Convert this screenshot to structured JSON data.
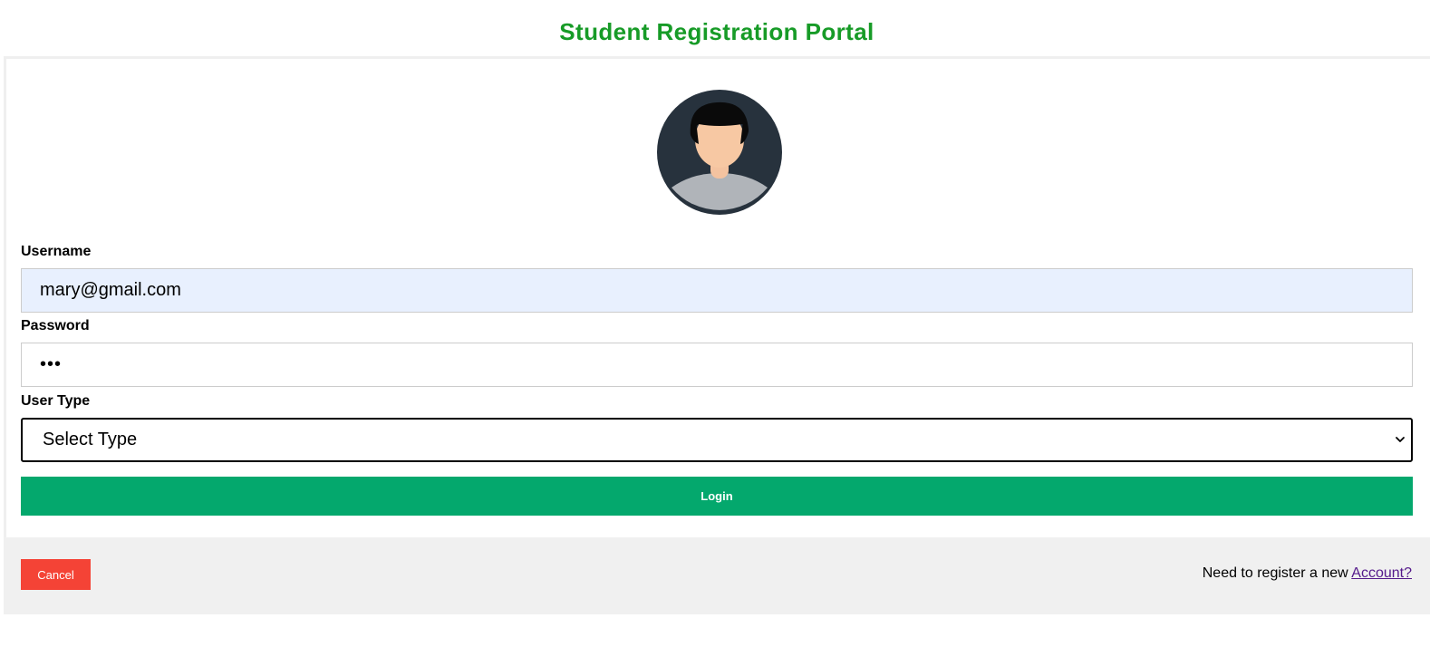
{
  "page": {
    "title": "Student Registration Portal"
  },
  "avatar": {
    "icon": "user-avatar-icon"
  },
  "form": {
    "username_label": "Username",
    "username_value": "mary@gmail.com",
    "password_label": "Password",
    "password_value": "•••",
    "user_type_label": "User Type",
    "user_type_selected": "Select Type",
    "login_label": "Login"
  },
  "footer": {
    "cancel_label": "Cancel",
    "register_prompt": "Need to register a new ",
    "register_link": "Account?"
  },
  "colors": {
    "title": "#179b27",
    "login_button": "#04a86d",
    "cancel_button": "#f44336",
    "autofill_background": "#e8f0fe",
    "footer_background": "#f0f0f0",
    "link": "#551a8b"
  }
}
